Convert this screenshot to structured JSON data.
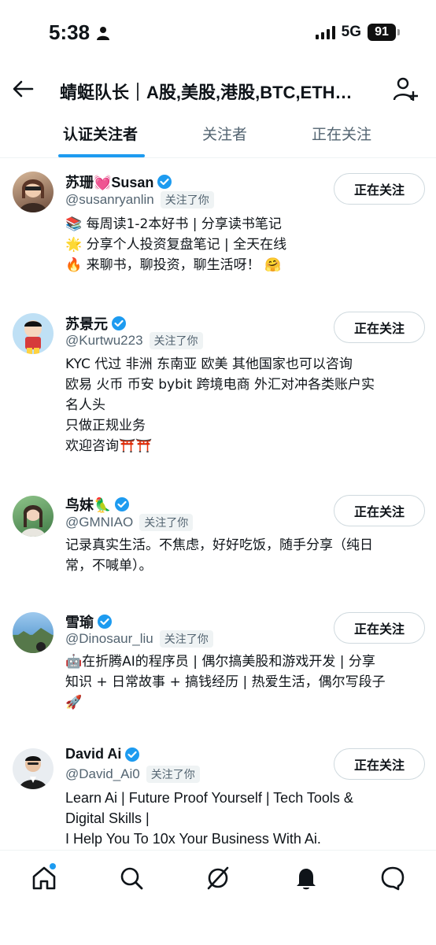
{
  "status_bar": {
    "time": "5:38",
    "network": "5G",
    "battery": "91"
  },
  "header": {
    "title": "蜻蜓队长｜A股,美股,港股,BTC,ETH…"
  },
  "tabs": [
    {
      "label": "认证关注者"
    },
    {
      "label": "关注者"
    },
    {
      "label": "正在关注"
    }
  ],
  "users": [
    {
      "name": "苏珊💓Susan",
      "handle": "@susanryanlin",
      "follows_you": "关注了你",
      "button": "正在关注",
      "bio": [
        "📚 每周读1-2本好书 | 分享读书笔记",
        "🌟 分享个人投资复盘笔记 | 全天在线",
        "🔥 来聊书，聊投资，聊生活呀！ 🤗"
      ]
    },
    {
      "name": "苏景元",
      "handle": "@Kurtwu223",
      "follows_you": "关注了你",
      "button": "正在关注",
      "bio": [
        "KYC 代过 非洲 东南亚 欧美 其他国家也可以咨询",
        "欧易 火币 币安 bybit 跨境电商 外汇对冲各类账户实",
        "名人头",
        "只做正规业务",
        "欢迎咨询⛩️⛩️"
      ]
    },
    {
      "name": "鸟妹🦜",
      "handle": "@GMNIAO",
      "follows_you": "关注了你",
      "button": "正在关注",
      "bio": [
        "记录真实生活。不焦虑，好好吃饭，随手分享（纯日",
        "常，不喊单）。"
      ]
    },
    {
      "name": "雪瑜",
      "handle": "@Dinosaur_liu",
      "follows_you": "关注了你",
      "button": "正在关注",
      "bio": [
        "🤖在折腾AI的程序员 | 偶尔搞美股和游戏开发 | 分享",
        "知识 + 日常故事 + 搞钱经历 | 热爱生活，偶尔写段子",
        "🚀"
      ]
    },
    {
      "name": "David Ai",
      "handle": "@David_Ai0",
      "follows_you": "关注了你",
      "button": "正在关注",
      "bio": [
        "Learn Ai | Future Proof Yourself | Tech Tools &",
        "Digital Skills |",
        "I Help You To 10x Your Business With Ai."
      ]
    }
  ],
  "colors": {
    "accent": "#1d9bf0",
    "text": "#0f1419",
    "secondary": "#536471"
  }
}
